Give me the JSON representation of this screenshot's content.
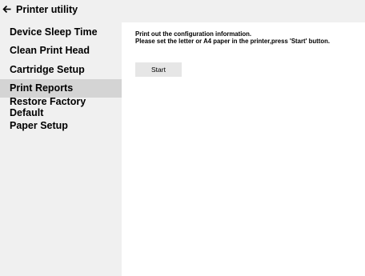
{
  "window": {
    "title": "Printer utility",
    "back_icon": "arrow-left-icon"
  },
  "sidebar": {
    "selected_index": 3,
    "items": [
      {
        "label": "Device Sleep Time"
      },
      {
        "label": "Clean Print Head"
      },
      {
        "label": "Cartridge Setup"
      },
      {
        "label": "Print Reports"
      },
      {
        "label": "Restore Factory Default"
      },
      {
        "label": "Paper Setup"
      }
    ]
  },
  "main": {
    "info_line1": "Print out the configuration information.",
    "info_line2": "Please set the letter or A4 paper in the printer,press 'Start' button.",
    "start_label": "Start"
  },
  "colors": {
    "panel_bg": "#f0f0f0",
    "selected_bg": "#d4d4d4",
    "button_bg": "#e6e6e6",
    "content_bg": "#ffffff"
  }
}
